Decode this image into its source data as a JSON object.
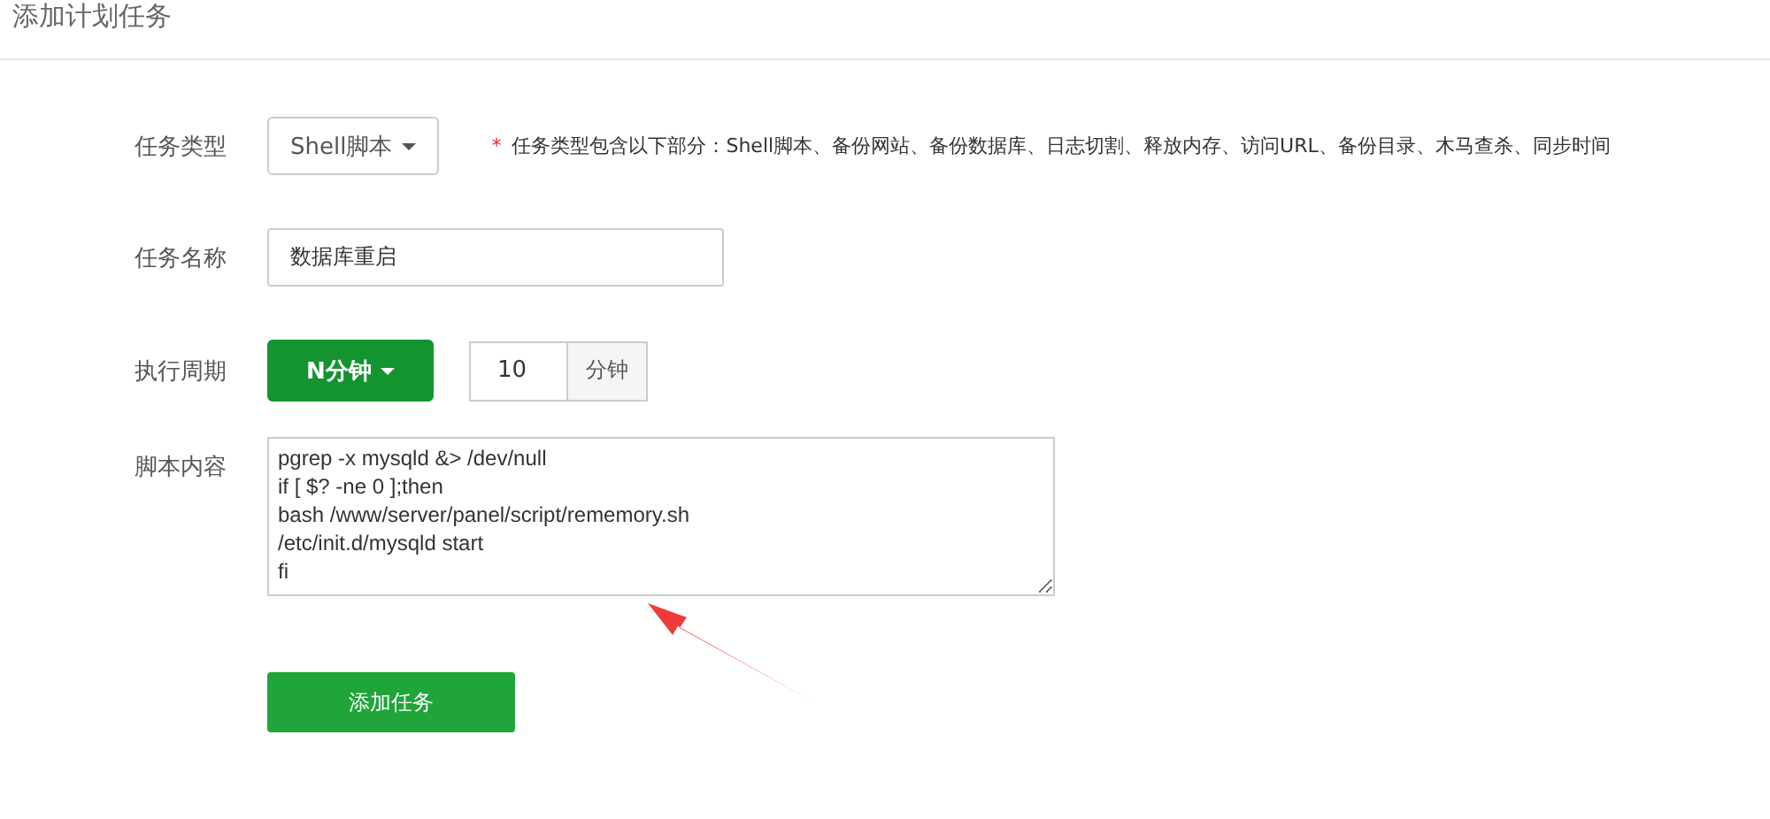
{
  "title": "添加计划任务",
  "form": {
    "task_type": {
      "label": "任务类型",
      "value": "Shell脚本",
      "note_mark": "*",
      "note": "任务类型包含以下部分：Shell脚本、备份网站、备份数据库、日志切割、释放内存、访问URL、备份目录、木马查杀、同步时间"
    },
    "task_name": {
      "label": "任务名称",
      "value": "数据库重启"
    },
    "period": {
      "label": "执行周期",
      "mode": "N分钟",
      "value": "10",
      "unit": "分钟"
    },
    "script": {
      "label": "脚本内容",
      "value": "pgrep -x mysqld &> /dev/null\nif [ $? -ne 0 ];then\nbash /www/server/panel/script/rememory.sh\n/etc/init.d/mysqld start\nfi"
    },
    "submit": "添加任务"
  }
}
